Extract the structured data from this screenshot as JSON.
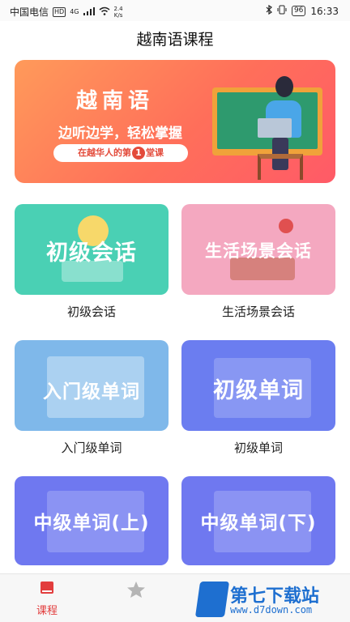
{
  "status_bar": {
    "carrier": "中国电信",
    "hd": "HD",
    "signal": "4G",
    "speed_value": "2.4",
    "speed_unit": "K/s",
    "battery": "96",
    "time": "16:33"
  },
  "header": {
    "title": "越南语课程"
  },
  "banner": {
    "title": "越南语",
    "subtitle": "边听边学，轻松掌握",
    "pill_before": "在越华人的第",
    "pill_num": "1",
    "pill_after": "堂课"
  },
  "courses": [
    {
      "image_text": "初级会话",
      "caption": "初级会话"
    },
    {
      "image_text": "生活场景会话",
      "caption": "生活场景会话"
    },
    {
      "image_text": "入门级单词",
      "caption": "入门级单词"
    },
    {
      "image_text": "初级单词",
      "caption": "初级单词"
    },
    {
      "image_text": "中级单词(上)",
      "caption": ""
    },
    {
      "image_text": "中级单词(下)",
      "caption": ""
    }
  ],
  "tabbar": {
    "course_label": "课程",
    "course_color": "#e23d3d"
  },
  "watermark": {
    "text": "第七下载站",
    "url": "www.d7down.com"
  }
}
